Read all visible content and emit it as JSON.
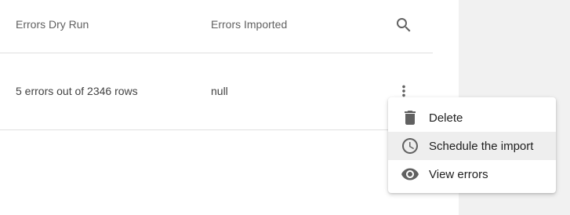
{
  "table": {
    "headers": [
      "Errors Dry Run",
      "Errors Imported"
    ],
    "rows": [
      {
        "errors_dry_run": "5 errors out of 2346 rows",
        "errors_imported": "null"
      }
    ]
  },
  "icons": {
    "search": "search-icon",
    "row_menu": "more-vert-icon"
  },
  "context_menu": {
    "items": [
      {
        "label": "Delete",
        "icon": "trash-icon"
      },
      {
        "label": "Schedule the import",
        "icon": "clock-icon",
        "highlighted": true
      },
      {
        "label": "View errors",
        "icon": "eye-icon"
      }
    ]
  },
  "colors": {
    "icon": "#616161",
    "divider": "#e0e0e0",
    "highlight": "#eeeeee"
  }
}
